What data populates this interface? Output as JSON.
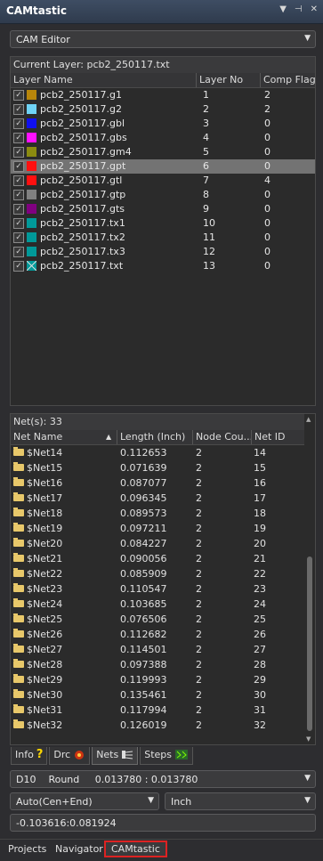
{
  "window": {
    "title": "CAMtastic",
    "icons": [
      "pin-icon",
      "float-icon",
      "close-icon"
    ]
  },
  "editor_select": {
    "value": "CAM Editor"
  },
  "layers": {
    "caption": "Current Layer: pcb2_250117.txt",
    "headers": {
      "name": "Layer Name",
      "no": "Layer No",
      "flag": "Comp Flag"
    },
    "rows": [
      {
        "name": "pcb2_250117.g1",
        "no": "1",
        "flag": "2",
        "color": "#b8860b"
      },
      {
        "name": "pcb2_250117.g2",
        "no": "2",
        "flag": "2",
        "color": "#6fd3f5"
      },
      {
        "name": "pcb2_250117.gbl",
        "no": "3",
        "flag": "0",
        "color": "#1010f0"
      },
      {
        "name": "pcb2_250117.gbs",
        "no": "4",
        "flag": "0",
        "color": "#ff10ff"
      },
      {
        "name": "pcb2_250117.gm4",
        "no": "5",
        "flag": "0",
        "color": "#8b8b10"
      },
      {
        "name": "pcb2_250117.gpt",
        "no": "6",
        "flag": "0",
        "color": "#ff1010",
        "selected": true
      },
      {
        "name": "pcb2_250117.gtl",
        "no": "7",
        "flag": "4",
        "color": "#ff1010"
      },
      {
        "name": "pcb2_250117.gtp",
        "no": "8",
        "flag": "0",
        "color": "#808080"
      },
      {
        "name": "pcb2_250117.gts",
        "no": "9",
        "flag": "0",
        "color": "#800080"
      },
      {
        "name": "pcb2_250117.tx1",
        "no": "10",
        "flag": "0",
        "color": "#009999"
      },
      {
        "name": "pcb2_250117.tx2",
        "no": "11",
        "flag": "0",
        "color": "#009999"
      },
      {
        "name": "pcb2_250117.tx3",
        "no": "12",
        "flag": "0",
        "color": "#009999"
      },
      {
        "name": "pcb2_250117.txt",
        "no": "13",
        "flag": "0",
        "color": "#009999",
        "crossed": true
      }
    ]
  },
  "nets": {
    "caption": "Net(s): 33",
    "headers": {
      "name": "Net Name",
      "length": "Length (Inch)",
      "nodes": "Node Cou...",
      "id": "Net ID"
    },
    "rows": [
      {
        "name": "$Net14",
        "length": "0.112653",
        "nodes": "2",
        "id": "14"
      },
      {
        "name": "$Net15",
        "length": "0.071639",
        "nodes": "2",
        "id": "15"
      },
      {
        "name": "$Net16",
        "length": "0.087077",
        "nodes": "2",
        "id": "16"
      },
      {
        "name": "$Net17",
        "length": "0.096345",
        "nodes": "2",
        "id": "17"
      },
      {
        "name": "$Net18",
        "length": "0.089573",
        "nodes": "2",
        "id": "18"
      },
      {
        "name": "$Net19",
        "length": "0.097211",
        "nodes": "2",
        "id": "19"
      },
      {
        "name": "$Net20",
        "length": "0.084227",
        "nodes": "2",
        "id": "20"
      },
      {
        "name": "$Net21",
        "length": "0.090056",
        "nodes": "2",
        "id": "21"
      },
      {
        "name": "$Net22",
        "length": "0.085909",
        "nodes": "2",
        "id": "22"
      },
      {
        "name": "$Net23",
        "length": "0.110547",
        "nodes": "2",
        "id": "23"
      },
      {
        "name": "$Net24",
        "length": "0.103685",
        "nodes": "2",
        "id": "24"
      },
      {
        "name": "$Net25",
        "length": "0.076506",
        "nodes": "2",
        "id": "25"
      },
      {
        "name": "$Net26",
        "length": "0.112682",
        "nodes": "2",
        "id": "26"
      },
      {
        "name": "$Net27",
        "length": "0.114501",
        "nodes": "2",
        "id": "27"
      },
      {
        "name": "$Net28",
        "length": "0.097388",
        "nodes": "2",
        "id": "28"
      },
      {
        "name": "$Net29",
        "length": "0.119993",
        "nodes": "2",
        "id": "29"
      },
      {
        "name": "$Net30",
        "length": "0.135461",
        "nodes": "2",
        "id": "30"
      },
      {
        "name": "$Net31",
        "length": "0.117994",
        "nodes": "2",
        "id": "31"
      },
      {
        "name": "$Net32",
        "length": "0.126019",
        "nodes": "2",
        "id": "32"
      }
    ]
  },
  "tabs": [
    {
      "label": "Info",
      "icon": "question-icon"
    },
    {
      "label": "Drc",
      "icon": "drc-icon"
    },
    {
      "label": "Nets",
      "icon": "nets-icon",
      "active": true
    },
    {
      "label": "Steps",
      "icon": "steps-icon"
    }
  ],
  "aperture_select": {
    "value": "D10    Round     0.013780 : 0.013780"
  },
  "mode_select": {
    "value": "Auto(Cen+End)"
  },
  "units_select": {
    "value": "Inch"
  },
  "coords": {
    "value": "-0.103616:0.081924"
  },
  "bottom_tabs": [
    {
      "label": "Projects"
    },
    {
      "label": "Navigator"
    },
    {
      "label": "CAMtastic",
      "active": true
    }
  ]
}
